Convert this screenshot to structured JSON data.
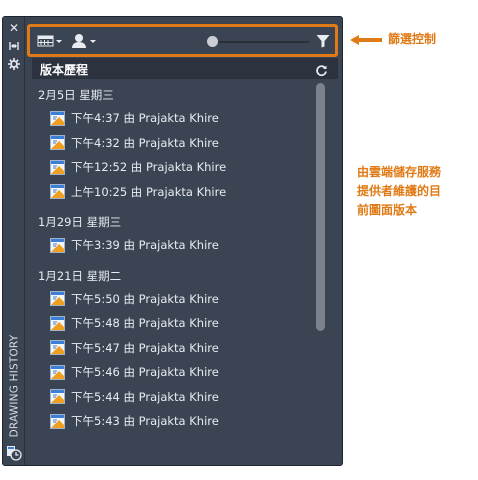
{
  "palette": {
    "side_title": "DRAWING HISTORY",
    "close_glyph": "✕",
    "header_title": "版本歷程"
  },
  "groups": [
    {
      "date": "2月5日 星期三",
      "items": [
        {
          "label": "下午4:37 由 Prajakta Khire"
        },
        {
          "label": "下午4:32 由 Prajakta Khire"
        },
        {
          "label": "下午12:52 由 Prajakta Khire"
        },
        {
          "label": "上午10:25 由 Prajakta Khire"
        }
      ]
    },
    {
      "date": "1月29日 星期三",
      "items": [
        {
          "label": "下午3:39 由 Prajakta Khire"
        }
      ]
    },
    {
      "date": "1月21日 星期二",
      "items": [
        {
          "label": "下午5:50 由 Prajakta Khire"
        },
        {
          "label": "下午5:48 由 Prajakta Khire"
        },
        {
          "label": "下午5:47 由 Prajakta Khire"
        },
        {
          "label": "下午5:46 由 Prajakta Khire"
        },
        {
          "label": "下午5:44 由 Prajakta Khire"
        },
        {
          "label": "下午5:43 由 Prajakta Khire"
        }
      ]
    }
  ],
  "annotations": {
    "filter_control": "篩選控制",
    "versions_note_line1": "由雲端儲存服務",
    "versions_note_line2": "提供者維護的目",
    "versions_note_line3": "前圖面版本"
  },
  "colors": {
    "accent": "#e07a16",
    "panel": "#3b4453",
    "header": "#2c333f"
  }
}
